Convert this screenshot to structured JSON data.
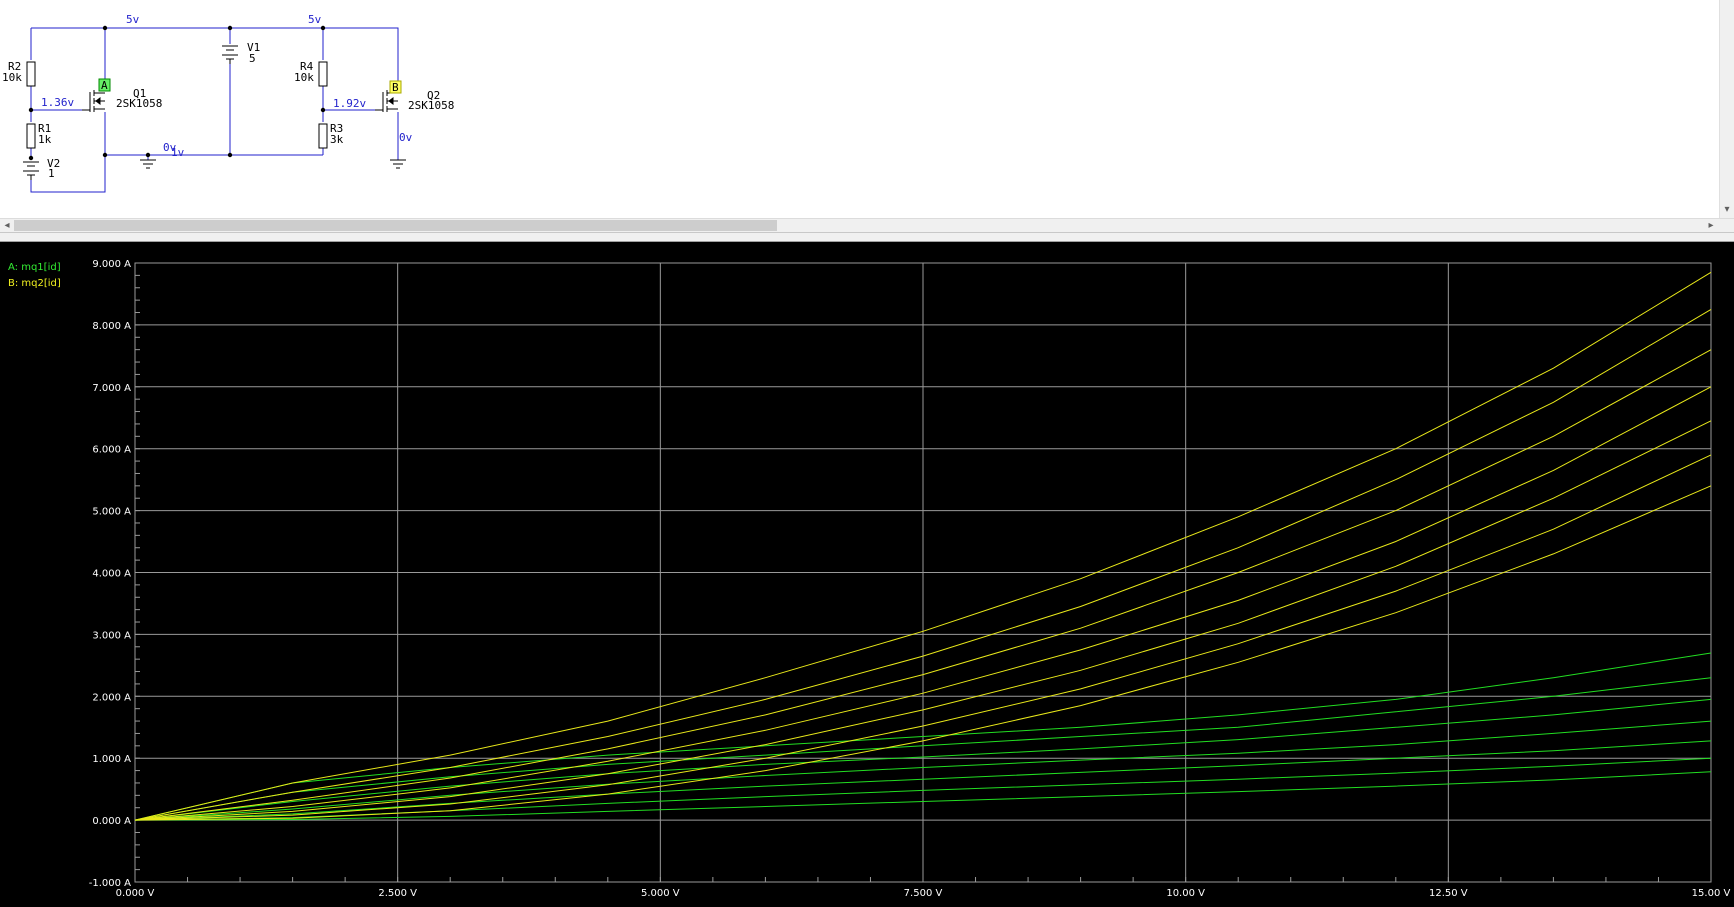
{
  "schematic": {
    "net_labels": {
      "top_left": "5v",
      "top_right": "5v",
      "gate_q1": "1.36v",
      "gate_q2": "1.92v",
      "ground": "0v",
      "ground_v2": "1v",
      "drain_q2": "0v"
    },
    "probes": {
      "a": "A",
      "b": "B"
    },
    "components": {
      "r2": {
        "name": "R2",
        "value": "10k"
      },
      "r1": {
        "name": "R1",
        "value": "1k"
      },
      "v2": {
        "name": "V2",
        "value": "1"
      },
      "q1": {
        "name": "Q1",
        "model": "2SK1058"
      },
      "v1": {
        "name": "V1",
        "value": "5"
      },
      "r4": {
        "name": "R4",
        "value": "10k"
      },
      "r3": {
        "name": "R3",
        "value": "3k"
      },
      "q2": {
        "name": "Q2",
        "model": "2SK1058"
      }
    }
  },
  "legend": {
    "series_a": "A: mq1[id]",
    "series_b": "B: mq2[id]"
  },
  "colors": {
    "series_a": "#22dd22",
    "series_b": "#e8e81a",
    "grid": "#9a9a9a",
    "background": "#000000",
    "wire": "#2222cc"
  },
  "chart_data": {
    "type": "line",
    "xlabel": "",
    "ylabel": "",
    "xlim": [
      0,
      15
    ],
    "ylim": [
      -1,
      9
    ],
    "x_ticks": [
      "0.000 V",
      "2.500 V",
      "5.000 V",
      "7.500 V",
      "10.00 V",
      "12.50 V",
      "15.00 V"
    ],
    "y_ticks": [
      "-1.000 A",
      "0.000 A",
      "1.000 A",
      "2.000 A",
      "3.000 A",
      "4.000 A",
      "5.000 A",
      "6.000 A",
      "7.000 A",
      "8.000 A",
      "9.000 A"
    ],
    "x": [
      0,
      1.5,
      3,
      4.5,
      6,
      7.5,
      9,
      10.5,
      12,
      13.5,
      15
    ],
    "series": [
      {
        "name": "A: mq1[id]",
        "values": [
          0,
          0.6,
          0.85,
          1.05,
          1.2,
          1.35,
          1.5,
          1.7,
          1.95,
          2.3,
          2.7
        ]
      },
      {
        "name": "A: mq1[id]",
        "values": [
          0,
          0.45,
          0.7,
          0.9,
          1.05,
          1.2,
          1.35,
          1.5,
          1.75,
          2.0,
          2.3
        ]
      },
      {
        "name": "A: mq1[id]",
        "values": [
          0,
          0.3,
          0.55,
          0.75,
          0.9,
          1.02,
          1.15,
          1.3,
          1.5,
          1.7,
          1.95
        ]
      },
      {
        "name": "A: mq1[id]",
        "values": [
          0,
          0.18,
          0.4,
          0.58,
          0.72,
          0.85,
          0.97,
          1.08,
          1.22,
          1.4,
          1.6
        ]
      },
      {
        "name": "A: mq1[id]",
        "values": [
          0,
          0.1,
          0.27,
          0.42,
          0.55,
          0.66,
          0.77,
          0.88,
          1.0,
          1.12,
          1.28
        ]
      },
      {
        "name": "A: mq1[id]",
        "values": [
          0,
          0.04,
          0.15,
          0.27,
          0.38,
          0.48,
          0.57,
          0.66,
          0.76,
          0.87,
          1.0
        ]
      },
      {
        "name": "A: mq1[id]",
        "values": [
          0,
          0.01,
          0.06,
          0.14,
          0.22,
          0.3,
          0.38,
          0.46,
          0.55,
          0.65,
          0.78
        ]
      },
      {
        "name": "B: mq2[id]",
        "values": [
          0,
          0.6,
          1.05,
          1.6,
          2.3,
          3.05,
          3.9,
          4.9,
          6.0,
          7.3,
          8.85
        ]
      },
      {
        "name": "B: mq2[id]",
        "values": [
          0,
          0.45,
          0.85,
          1.35,
          1.95,
          2.65,
          3.45,
          4.4,
          5.5,
          6.75,
          8.25
        ]
      },
      {
        "name": "B: mq2[id]",
        "values": [
          0,
          0.32,
          0.68,
          1.15,
          1.7,
          2.35,
          3.1,
          4.0,
          5.0,
          6.2,
          7.6
        ]
      },
      {
        "name": "B: mq2[id]",
        "values": [
          0,
          0.22,
          0.52,
          0.95,
          1.45,
          2.05,
          2.75,
          3.55,
          4.5,
          5.65,
          7.0
        ]
      },
      {
        "name": "B: mq2[id]",
        "values": [
          0,
          0.14,
          0.38,
          0.75,
          1.22,
          1.78,
          2.42,
          3.18,
          4.1,
          5.2,
          6.45
        ]
      },
      {
        "name": "B: mq2[id]",
        "values": [
          0,
          0.08,
          0.26,
          0.57,
          1.0,
          1.52,
          2.12,
          2.85,
          3.7,
          4.7,
          5.9
        ]
      },
      {
        "name": "B: mq2[id]",
        "values": [
          0,
          0.03,
          0.15,
          0.42,
          0.8,
          1.28,
          1.85,
          2.55,
          3.35,
          4.3,
          5.4
        ]
      }
    ],
    "grid": true,
    "legend_position": "top-left"
  }
}
